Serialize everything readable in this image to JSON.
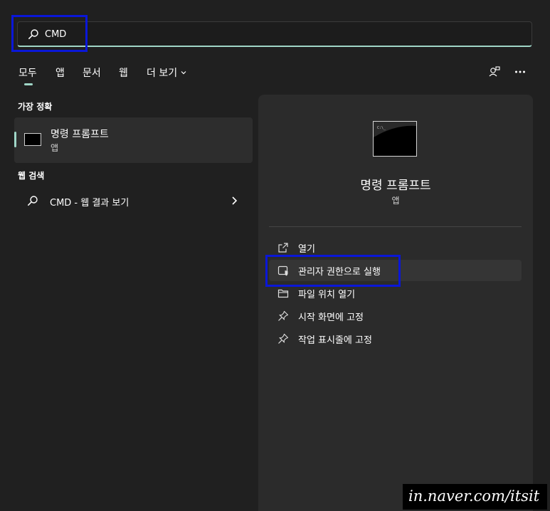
{
  "search": {
    "value": "CMD",
    "placeholder": ""
  },
  "tabs": [
    {
      "label": "모두"
    },
    {
      "label": "앱"
    },
    {
      "label": "문서"
    },
    {
      "label": "웹"
    },
    {
      "label": "더 보기"
    }
  ],
  "sections": {
    "best_match": "가장 정확",
    "web_search": "웹 검색"
  },
  "best_match": {
    "title": "명령 프롬프트",
    "subtitle": "앱"
  },
  "web_result": {
    "label": "CMD - 웹 결과 보기"
  },
  "preview": {
    "title": "명령 프롬프트",
    "subtitle": "앱",
    "actions": [
      {
        "label": "열기",
        "icon": "open-external-icon"
      },
      {
        "label": "관리자 권한으로 실행",
        "icon": "shield-icon"
      },
      {
        "label": "파일 위치 열기",
        "icon": "folder-icon"
      },
      {
        "label": "시작 화면에 고정",
        "icon": "pin-icon"
      },
      {
        "label": "작업 표시줄에 고정",
        "icon": "pin-icon"
      }
    ]
  },
  "watermark": "in.naver.com/itsit",
  "colors": {
    "accent": "#9fd6c7",
    "highlight_box": "#0a17d8",
    "background": "#202020",
    "panel": "#2b2b2b"
  }
}
